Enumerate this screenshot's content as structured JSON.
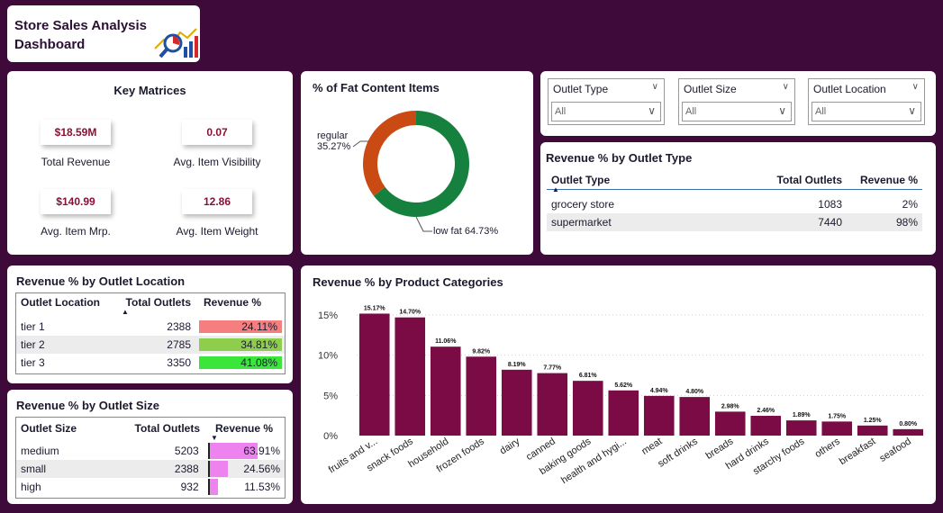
{
  "dashboard": {
    "title_line1": "Store Sales Analysis",
    "title_line2": "Dashboard",
    "icon": "analytics-chart-icon"
  },
  "key_metrics": {
    "title": "Key Matrices",
    "items": [
      {
        "value": "$18.59M",
        "label": "Total Revenue"
      },
      {
        "value": "0.07",
        "label": "Avg. Item Visibility"
      },
      {
        "value": "$140.99",
        "label": "Avg. Item Mrp."
      },
      {
        "value": "12.86",
        "label": "Avg. Item Weight"
      }
    ]
  },
  "fat_content": {
    "title": "% of Fat Content Items",
    "regular_label": "regular",
    "regular_pct": "35.27%",
    "lowfat_label": "low fat 64.73%",
    "regular_value": 35.27,
    "lowfat_value": 64.73,
    "colors": {
      "regular": "#c94a12",
      "low_fat": "#16813f"
    }
  },
  "slicers": [
    {
      "title": "Outlet Type",
      "value": "All"
    },
    {
      "title": "Outlet Size",
      "value": "All"
    },
    {
      "title": "Outlet Location",
      "value": "All"
    }
  ],
  "outlet_type": {
    "title": "Revenue % by Outlet Type",
    "headers": [
      "Outlet Type",
      "Total Outlets",
      "Revenue %"
    ],
    "rows": [
      {
        "name": "grocery store",
        "outlets": "1083",
        "revenue": "2%"
      },
      {
        "name": "supermarket",
        "outlets": "7440",
        "revenue": "98%"
      }
    ]
  },
  "outlet_location": {
    "title": "Revenue % by Outlet Location",
    "headers": [
      "Outlet Location",
      "Total Outlets",
      "Revenue %"
    ],
    "rows": [
      {
        "name": "tier 1",
        "outlets": "2388",
        "revenue": "24.11%",
        "color": "#f57f7f"
      },
      {
        "name": "tier 2",
        "outlets": "2785",
        "revenue": "34.81%",
        "color": "#8fcd4c"
      },
      {
        "name": "tier 3",
        "outlets": "3350",
        "revenue": "41.08%",
        "color": "#3be63b"
      }
    ]
  },
  "outlet_size": {
    "title": "Revenue % by Outlet Size",
    "headers": [
      "Outlet Size",
      "Total Outlets",
      "Revenue %"
    ],
    "bar_color": "#ee82ee",
    "rows": [
      {
        "name": "medium",
        "outlets": "5203",
        "revenue": "63.91%",
        "pct": 63.91
      },
      {
        "name": "small",
        "outlets": "2388",
        "revenue": "24.56%",
        "pct": 24.56
      },
      {
        "name": "high",
        "outlets": "932",
        "revenue": "11.53%",
        "pct": 11.53
      }
    ]
  },
  "chart_data": {
    "type": "bar",
    "title": "Revenue % by Product Categories",
    "categories": [
      "fruits and v...",
      "snack foods",
      "household",
      "frozen foods",
      "dairy",
      "canned",
      "baking goods",
      "health and hygi...",
      "meat",
      "soft drinks",
      "breads",
      "hard drinks",
      "starchy foods",
      "others",
      "breakfast",
      "seafood"
    ],
    "values": [
      15.17,
      14.7,
      11.06,
      9.82,
      8.19,
      7.77,
      6.81,
      5.62,
      4.94,
      4.8,
      2.98,
      2.46,
      1.89,
      1.75,
      1.25,
      0.8
    ],
    "data_labels": [
      "15.17%",
      "14.70%",
      "11.06%",
      "9.82%",
      "8.19%",
      "7.77%",
      "6.81%",
      "5.62%",
      "4.94%",
      "4.80%",
      "2.98%",
      "2.46%",
      "1.89%",
      "1.75%",
      "1.25%",
      "0.80%"
    ],
    "ylim": [
      0,
      15
    ],
    "yticks": [
      0,
      5,
      10,
      15
    ],
    "ytick_labels": [
      "0%",
      "5%",
      "10%",
      "15%"
    ],
    "grid": true,
    "bar_color": "#7b0b45"
  }
}
